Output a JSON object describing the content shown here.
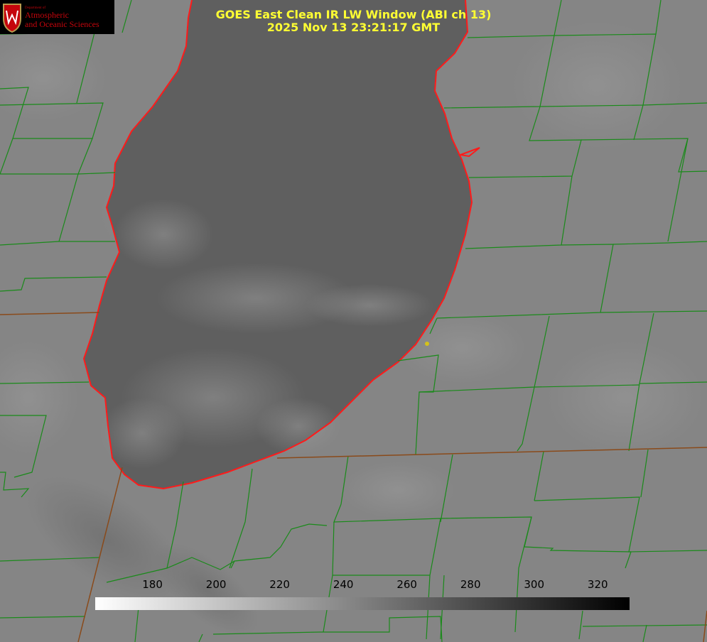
{
  "title": {
    "line1": "GOES East Clean IR LW Window (ABI ch 13)",
    "line2": "2025 Nov 13 23:21:17 GMT"
  },
  "logo": {
    "dept_line": "Department of",
    "name_line1": "Atmospheric",
    "name_line2": "and Oceanic Sciences"
  },
  "colorbar": {
    "range": [
      162,
      330
    ],
    "ticks": [
      "180",
      "200",
      "220",
      "240",
      "260",
      "280",
      "300",
      "320"
    ],
    "gradient": [
      "#ffffff",
      "#000000"
    ]
  },
  "colors": {
    "title": "#ffff33",
    "county_lines": "#1a8a1a",
    "state_lines": "#8a4a1a",
    "shoreline": "#ff1a1a",
    "lake": "#5c5c5c",
    "land": "#858585",
    "marker": "#d4c21a"
  },
  "icons": {
    "logo": "uw-crest-icon"
  }
}
